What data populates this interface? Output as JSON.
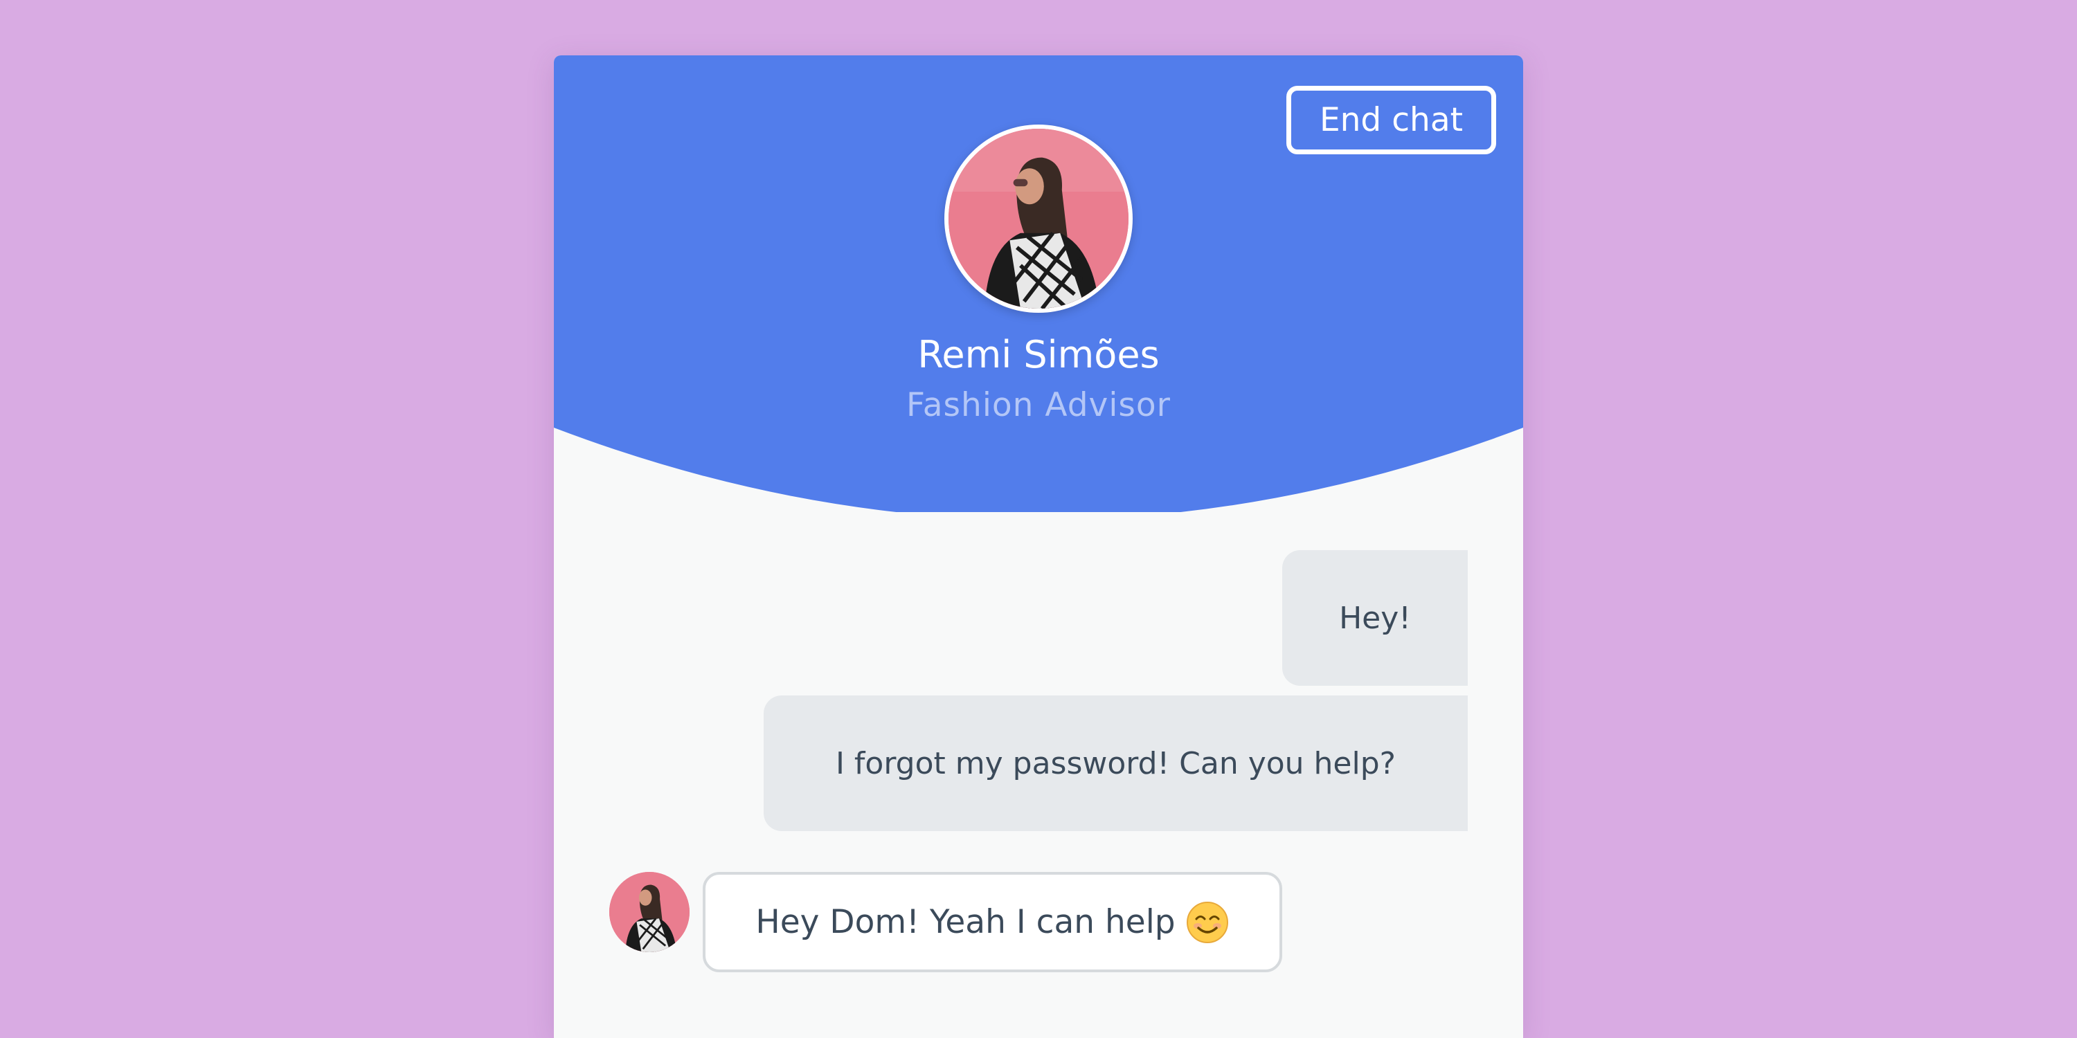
{
  "header": {
    "end_chat_label": "End chat",
    "agent_name": "Remi Simões",
    "agent_role": "Fashion Advisor",
    "avatar_icon": "person-photo-avatar"
  },
  "messages": {
    "outgoing": [
      {
        "text": "Hey!"
      },
      {
        "text": "I forgot my password! Can you help?"
      }
    ],
    "incoming": [
      {
        "text": "Hey Dom! Yeah I can help",
        "emoji_icon": "smiling-face-icon"
      }
    ]
  },
  "colors": {
    "page_background": "#d9abe3",
    "header_blue": "#527deb",
    "outgoing_bubble": "#e6e9ec",
    "incoming_bubble": "#ffffff",
    "text_dark": "#3b4a5a",
    "role_text": "#b3c6f7"
  }
}
